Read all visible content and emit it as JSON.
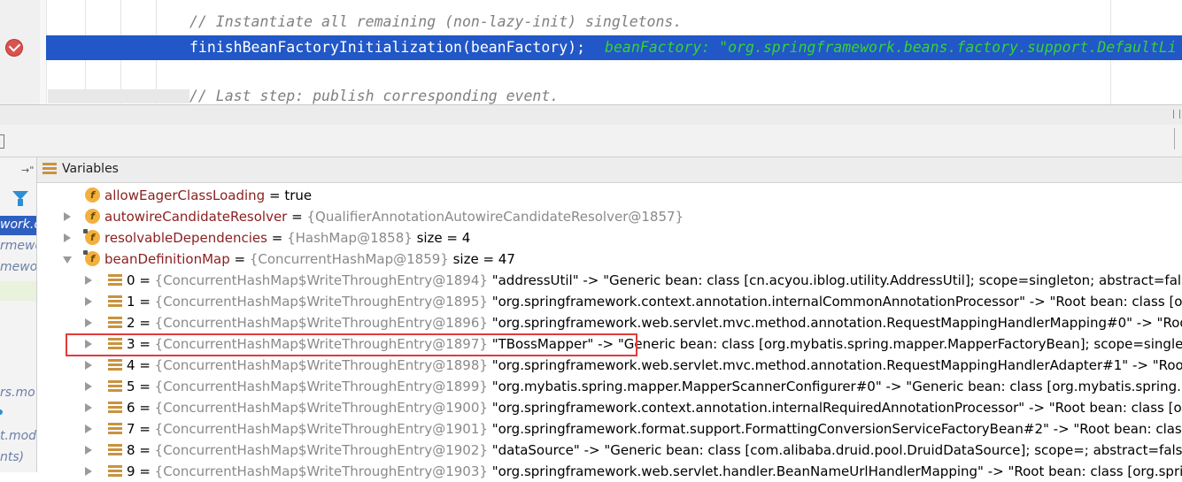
{
  "editor": {
    "line1_comment": "// Instantiate all remaining (non-lazy-init) singletons.",
    "line2_code": "finishBeanFactoryInitialization(beanFactory);",
    "line2_inline": "beanFactory: \"org.springframework.beans.factory.support.DefaultLi",
    "line3_comment": "// Last step: publish corresponding event."
  },
  "left_panel": {
    "items": [
      "work.c",
      "rmewo",
      "mewor",
      "rs.mo",
      "t.mod",
      "nts)"
    ]
  },
  "variables": {
    "title": "Variables",
    "rows": [
      {
        "name": "allowEagerClassLoading",
        "op": " = ",
        "ref": "",
        "value": "true"
      },
      {
        "name": "autowireCandidateResolver",
        "op": " = ",
        "ref": "{QualifierAnnotationAutowireCandidateResolver@1857}",
        "value": ""
      },
      {
        "name": "resolvableDependencies",
        "op": " = ",
        "ref": "{HashMap@1858}",
        "value": "  size = 4"
      },
      {
        "name": "beanDefinitionMap",
        "op": " = ",
        "ref": "{ConcurrentHashMap@1859}",
        "value": "  size = 47"
      }
    ],
    "entries": [
      {
        "idx": "0",
        "ref": "{ConcurrentHashMap$WriteThroughEntry@1894}",
        "value": "\"addressUtil\" -> \"Generic bean: class [cn.acyou.iblog.utility.AddressUtil]; scope=singleton; abstract=false; lazy"
      },
      {
        "idx": "1",
        "ref": "{ConcurrentHashMap$WriteThroughEntry@1895}",
        "value": "\"org.springframework.context.annotation.internalCommonAnnotationProcessor\" -> \"Root bean: class [org.sp"
      },
      {
        "idx": "2",
        "ref": "{ConcurrentHashMap$WriteThroughEntry@1896}",
        "value": "\"org.springframework.web.servlet.mvc.method.annotation.RequestMappingHandlerMapping#0\" -> \"Root be"
      },
      {
        "idx": "3",
        "ref": "{ConcurrentHashMap$WriteThroughEntry@1897}",
        "value": "\"TBossMapper\" -> \"Generic bean: class [org.mybatis.spring.mapper.MapperFactoryBean]; scope=singleton; al"
      },
      {
        "idx": "4",
        "ref": "{ConcurrentHashMap$WriteThroughEntry@1898}",
        "value": "\"org.springframework.web.servlet.mvc.method.annotation.RequestMappingHandlerAdapter#1\" -> \"Root bea"
      },
      {
        "idx": "5",
        "ref": "{ConcurrentHashMap$WriteThroughEntry@1899}",
        "value": "\"org.mybatis.spring.mapper.MapperScannerConfigurer#0\" -> \"Generic bean: class [org.mybatis.spring.mappe"
      },
      {
        "idx": "6",
        "ref": "{ConcurrentHashMap$WriteThroughEntry@1900}",
        "value": "\"org.springframework.context.annotation.internalRequiredAnnotationProcessor\" -> \"Root bean: class [org.sp"
      },
      {
        "idx": "7",
        "ref": "{ConcurrentHashMap$WriteThroughEntry@1901}",
        "value": "\"org.springframework.format.support.FormattingConversionServiceFactoryBean#2\" -> \"Root bean: class [org."
      },
      {
        "idx": "8",
        "ref": "{ConcurrentHashMap$WriteThroughEntry@1902}",
        "value": "\"dataSource\" -> \"Generic bean: class [com.alibaba.druid.pool.DruidDataSource]; scope=; abstract=false; lazyIn"
      },
      {
        "idx": "9",
        "ref": "{ConcurrentHashMap$WriteThroughEntry@1903}",
        "value": "\"org.springframework.web.servlet.handler.BeanNameUrlHandlerMapping\" -> \"Root bean: class [org.springframe"
      }
    ]
  },
  "colors": {
    "highlight": "#2157c7",
    "inline_value": "#36d136",
    "field_icon": "#f2b03f",
    "annotation_box": "#e23b3b"
  }
}
